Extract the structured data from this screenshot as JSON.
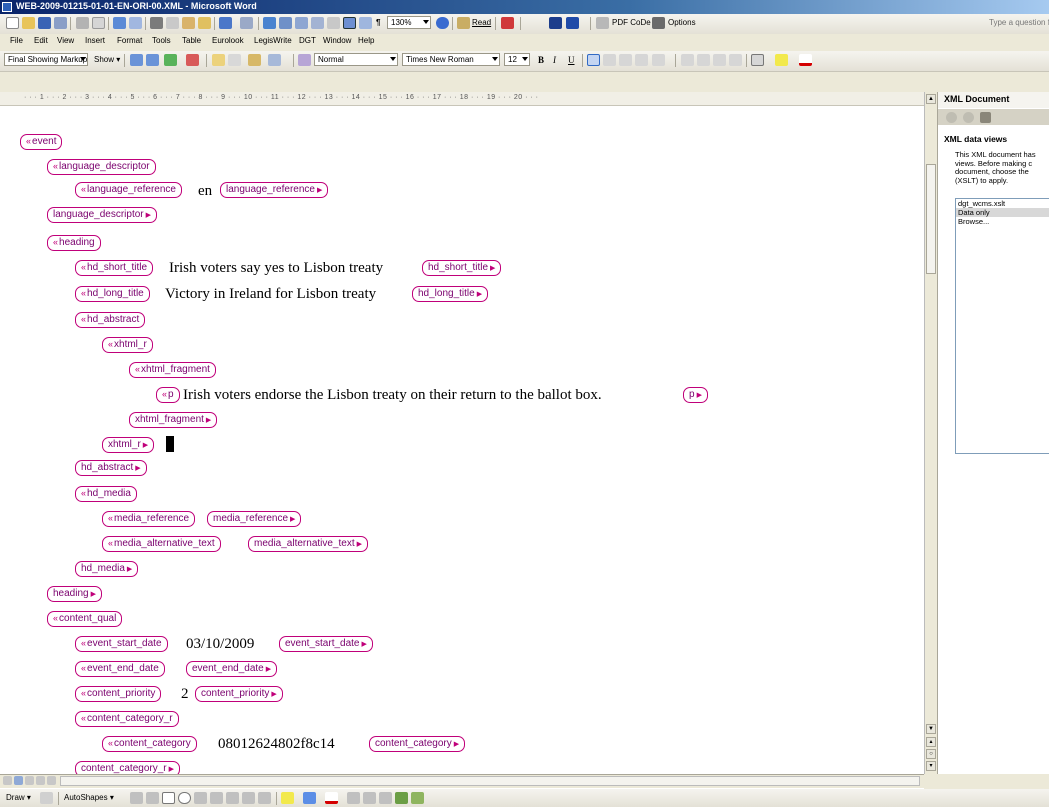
{
  "window": {
    "title": "WEB-2009-01215-01-01-EN-ORI-00.XML - Microsoft Word"
  },
  "toolbar_standard": {
    "zoom": "130%",
    "read_label": "Read",
    "pdf_label": "PDF CoDe",
    "options_label": "Options",
    "question_placeholder": "Type a question f"
  },
  "menu": [
    "File",
    "Edit",
    "View",
    "Insert",
    "Format",
    "Tools",
    "Table",
    "Eurolook",
    "LegisWrite",
    "DGT",
    "Window",
    "Help"
  ],
  "toolbar_formatting": {
    "markup_mode": "Final Showing Markup",
    "show_label": "Show",
    "style": "Normal",
    "font": "Times New Roman",
    "size": "12",
    "bold": "B",
    "italic": "I",
    "underline": "U"
  },
  "ruler": {
    "labels": "· · · 1 · · · 2 · · · 3 · · · 4 · · · 5 · · · 6 · · · 7 · · · 8 · · · 9 · · · 10 · · · 11 · · · 12 · · · 13 · · · 14 · · · 15 · · · 16 · · · 17 · · · 18 · · · 19 · · · 20 · · ·"
  },
  "document": {
    "tags": {
      "event": "event",
      "language_descriptor": "language_descriptor",
      "language_reference": "language_reference",
      "heading": "heading",
      "hd_short_title": "hd_short_title",
      "hd_long_title": "hd_long_title",
      "hd_abstract": "hd_abstract",
      "xhtml_r": "xhtml_r",
      "xhtml_fragment": "xhtml_fragment",
      "p": "p",
      "hd_media": "hd_media",
      "media_reference": "media_reference",
      "media_alternative_text": "media_alternative_text",
      "content_qual": "content_qual",
      "event_start_date": "event_start_date",
      "event_end_date": "event_end_date",
      "content_priority": "content_priority",
      "content_category_r": "content_category_r",
      "content_category": "content_category"
    },
    "values": {
      "language_reference": "en",
      "hd_short_title": "Irish voters say yes to Lisbon treaty",
      "hd_long_title": "Victory in Ireland for Lisbon treaty",
      "p": "Irish voters endorse the Lisbon treaty on their return to the ballot box.",
      "event_start_date": "03/10/2009",
      "content_priority": "2",
      "content_category": "08012624802f8c14"
    },
    "partial_last_tag": "content_category_r"
  },
  "task_pane": {
    "title": "XML Document",
    "subtitle": "XML data views",
    "description": "This XML document has views. Before making c document, choose the (XSLT) to apply.",
    "views": [
      "dgt_wcms.xslt",
      "Data only",
      "Browse..."
    ],
    "selected_view": "Data only"
  },
  "drawbar": {
    "draw_label": "Draw",
    "autoshapes_label": "AutoShapes"
  }
}
